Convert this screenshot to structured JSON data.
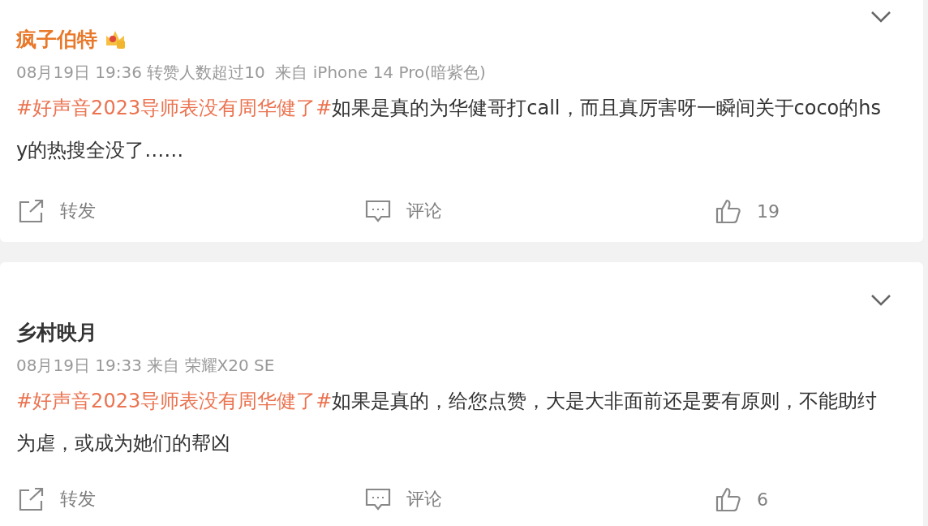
{
  "posts": [
    {
      "author": "疯子伯特",
      "vip": true,
      "meta": "08月19日 19:36 转赞人数超过10  来自 iPhone 14 Pro(暗紫色)",
      "topic": "#好声音2023导师表没有周华健了#",
      "text": "如果是真的为华健哥打call，而且真厉害呀一瞬间关于coco的hsy的热搜全没了……",
      "actions": {
        "repost": "转发",
        "comment": "评论",
        "likes": "19"
      }
    },
    {
      "author": "乡村映月",
      "vip": false,
      "meta": "08月19日 19:33 来自 荣耀X20 SE",
      "topic": "#好声音2023导师表没有周华健了#",
      "text": "如果是真的，给您点赞，大是大非面前还是要有原则，不能助纣为虐，或成为她们的帮凶",
      "actions": {
        "repost": "转发",
        "comment": "评论",
        "likes": "6"
      }
    }
  ]
}
